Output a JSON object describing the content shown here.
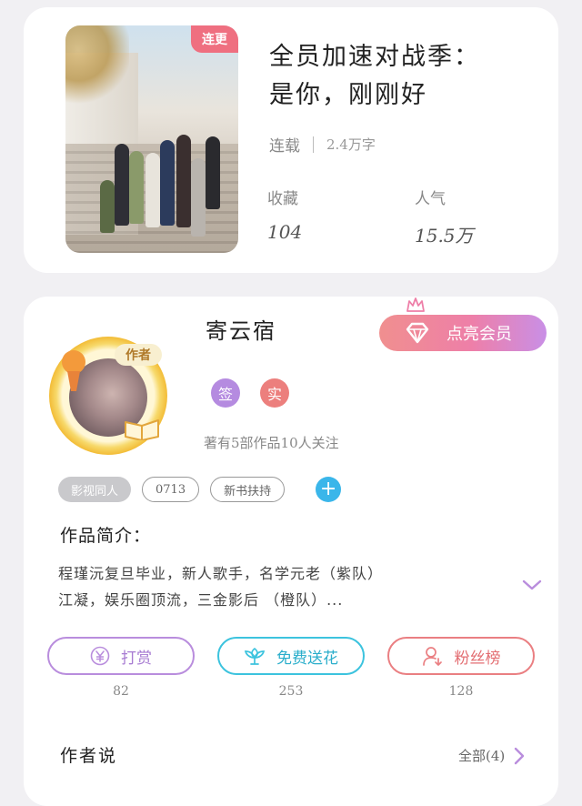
{
  "book": {
    "status_badge": "连更",
    "title_line1": "全员加速对战季：",
    "title_line2": "是你，刚刚好",
    "status": "连载",
    "word_count": "2.4万字",
    "favorites_label": "收藏",
    "favorites_value": "104",
    "popularity_label": "人气",
    "popularity_value": "15.5万"
  },
  "author": {
    "name": "寄云宿",
    "avatar_tag": "作者",
    "vip_label": "点亮会员",
    "badge_signed": "签",
    "badge_verified": "实",
    "works_summary": "著有5部作品10人关注",
    "tags": [
      "影视同人",
      "0713",
      "新书扶持"
    ],
    "add_tag": "+",
    "intro_title": "作品简介：",
    "intro_line1": "程瑾沅复旦毕业，新人歌手，名学元老（紫队）",
    "intro_line2": "江凝，娱乐圈顶流，三金影后  （橙队）..."
  },
  "actions": {
    "tip_label": "打赏",
    "tip_count": "82",
    "flower_label": "免费送花",
    "flower_count": "253",
    "fans_label": "粉丝榜",
    "fans_count": "128"
  },
  "author_say": {
    "title": "作者说",
    "all_label": "全部(4)"
  },
  "colors": {
    "accent_purple": "#b98ddd",
    "accent_cyan": "#3cc3de",
    "accent_red": "#ea7f82",
    "badge_red": "#ef6f80"
  },
  "icons": [
    "diamond-icon",
    "crown-icon",
    "yen-icon",
    "flower-icon",
    "person-icon",
    "chevron-down-icon",
    "chevron-right-icon",
    "plus-icon"
  ]
}
